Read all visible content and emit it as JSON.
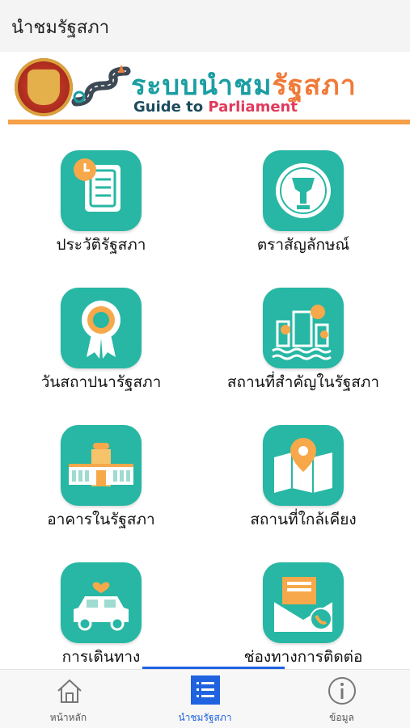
{
  "header": {
    "title": "นำชมรัฐสภา"
  },
  "banner": {
    "title_part1": "ระบบนำชม",
    "title_part2": "รัฐสภา",
    "subtitle_part1": "Guide to ",
    "subtitle_part2": "Parliament"
  },
  "menu": [
    {
      "label": "ประวัติรัฐสภา",
      "icon": "document-clock-icon"
    },
    {
      "label": "ตราสัญลักษณ์",
      "icon": "emblem-icon"
    },
    {
      "label": "วันสถาปนารัฐสภา",
      "icon": "ribbon-badge-icon"
    },
    {
      "label": "สถานที่สำคัญในรัฐสภา",
      "icon": "landmark-buildings-icon"
    },
    {
      "label": "อาคารในรัฐสภา",
      "icon": "building-icon"
    },
    {
      "label": "สถานที่ใกล้เคียง",
      "icon": "map-pin-icon"
    },
    {
      "label": "การเดินทาง",
      "icon": "car-icon"
    },
    {
      "label": "ช่องทางการติดต่อ",
      "icon": "mail-phone-icon"
    }
  ],
  "tabs": [
    {
      "label": "หน้าหลัก",
      "icon": "home-icon",
      "active": false
    },
    {
      "label": "นำชมรัฐสภา",
      "icon": "list-icon",
      "active": true
    },
    {
      "label": "ข้อมูล",
      "icon": "info-icon",
      "active": false
    }
  ],
  "colors": {
    "tile": "#27b7a4",
    "accent": "#1f63e0",
    "orange": "#f07b39",
    "teal": "#1b9ea2"
  }
}
